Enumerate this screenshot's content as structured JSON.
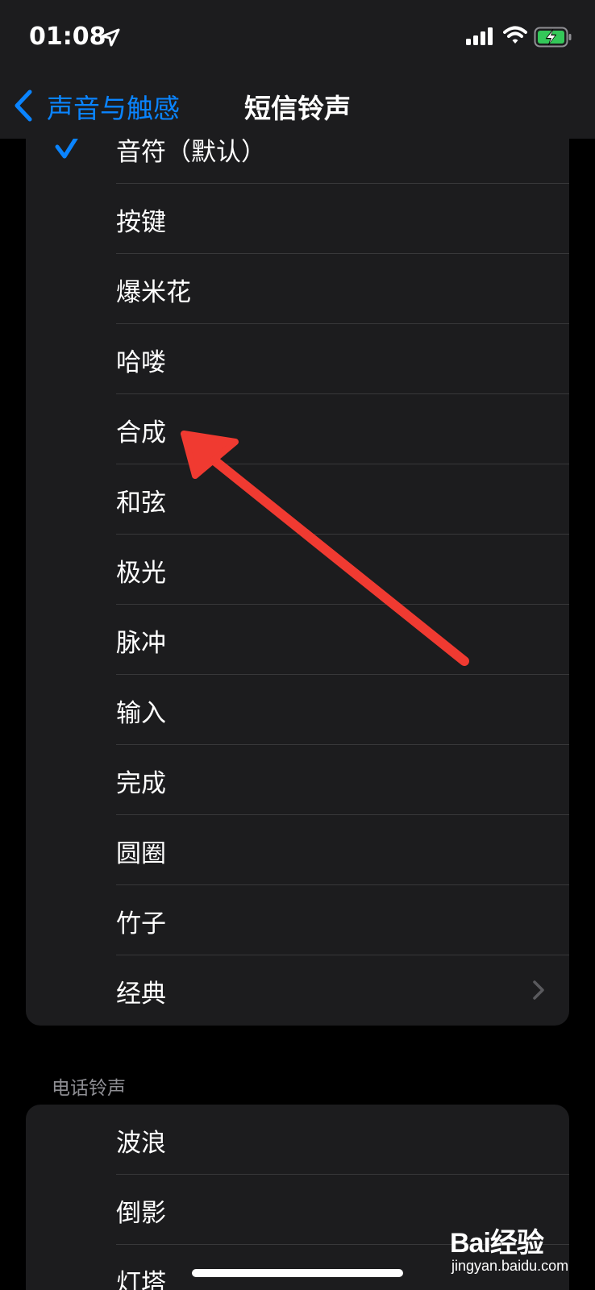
{
  "status_bar": {
    "time": "01:08",
    "icons": [
      "location-arrow-icon",
      "cellular-signal-icon",
      "wifi-icon",
      "battery-charging-icon"
    ],
    "battery_color": "#34c759"
  },
  "nav": {
    "back_label": "声音与触感",
    "title": "短信铃声",
    "accent_color": "#0a84ff"
  },
  "sms_tones": {
    "items": [
      {
        "label": "音符（默认）",
        "selected": true
      },
      {
        "label": "按键"
      },
      {
        "label": "爆米花"
      },
      {
        "label": "哈喽"
      },
      {
        "label": "合成"
      },
      {
        "label": "和弦"
      },
      {
        "label": "极光"
      },
      {
        "label": "脉冲"
      },
      {
        "label": "输入"
      },
      {
        "label": "完成"
      },
      {
        "label": "圆圈"
      },
      {
        "label": "竹子"
      },
      {
        "label": "经典",
        "has_chevron": true
      }
    ]
  },
  "ringtones": {
    "header": "电话铃声",
    "items": [
      {
        "label": "波浪"
      },
      {
        "label": "倒影"
      },
      {
        "label": "灯塔"
      }
    ]
  },
  "annotation": {
    "arrow_color": "#f03a31",
    "points_to": "合成"
  },
  "watermark": {
    "brand": "Bai经验",
    "sub": "jingyan.baidu.com"
  }
}
